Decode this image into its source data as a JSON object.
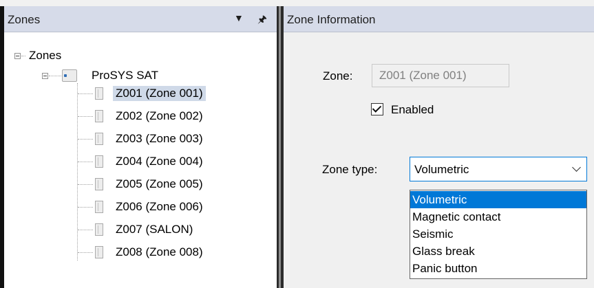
{
  "zones_pane": {
    "title": "Zones",
    "dropdown_icon": "caret-down-icon",
    "pin_icon": "pin-icon",
    "tree": {
      "root_label": "Zones",
      "device_label": "ProSYS SAT",
      "zones": [
        {
          "label": "Z001 (Zone 001)",
          "selected": true
        },
        {
          "label": "Z002 (Zone 002)"
        },
        {
          "label": "Z003 (Zone 003)"
        },
        {
          "label": "Z004 (Zone 004)"
        },
        {
          "label": "Z005 (Zone 005)"
        },
        {
          "label": "Z006 (Zone 006)"
        },
        {
          "label": "Z007 (SALON)"
        },
        {
          "label": "Z008 (Zone 008)"
        }
      ]
    }
  },
  "info_pane": {
    "title": "Zone Information",
    "zone_label": "Zone:",
    "zone_value": "Z001 (Zone 001)",
    "enabled_label": "Enabled",
    "enabled_checked": true,
    "zone_type_label": "Zone type:",
    "zone_type_selected": "Volumetric",
    "zone_type_options": [
      "Volumetric",
      "Magnetic contact",
      "Seismic",
      "Glass break",
      "Panic button"
    ],
    "accent_color": "#0078d7"
  }
}
